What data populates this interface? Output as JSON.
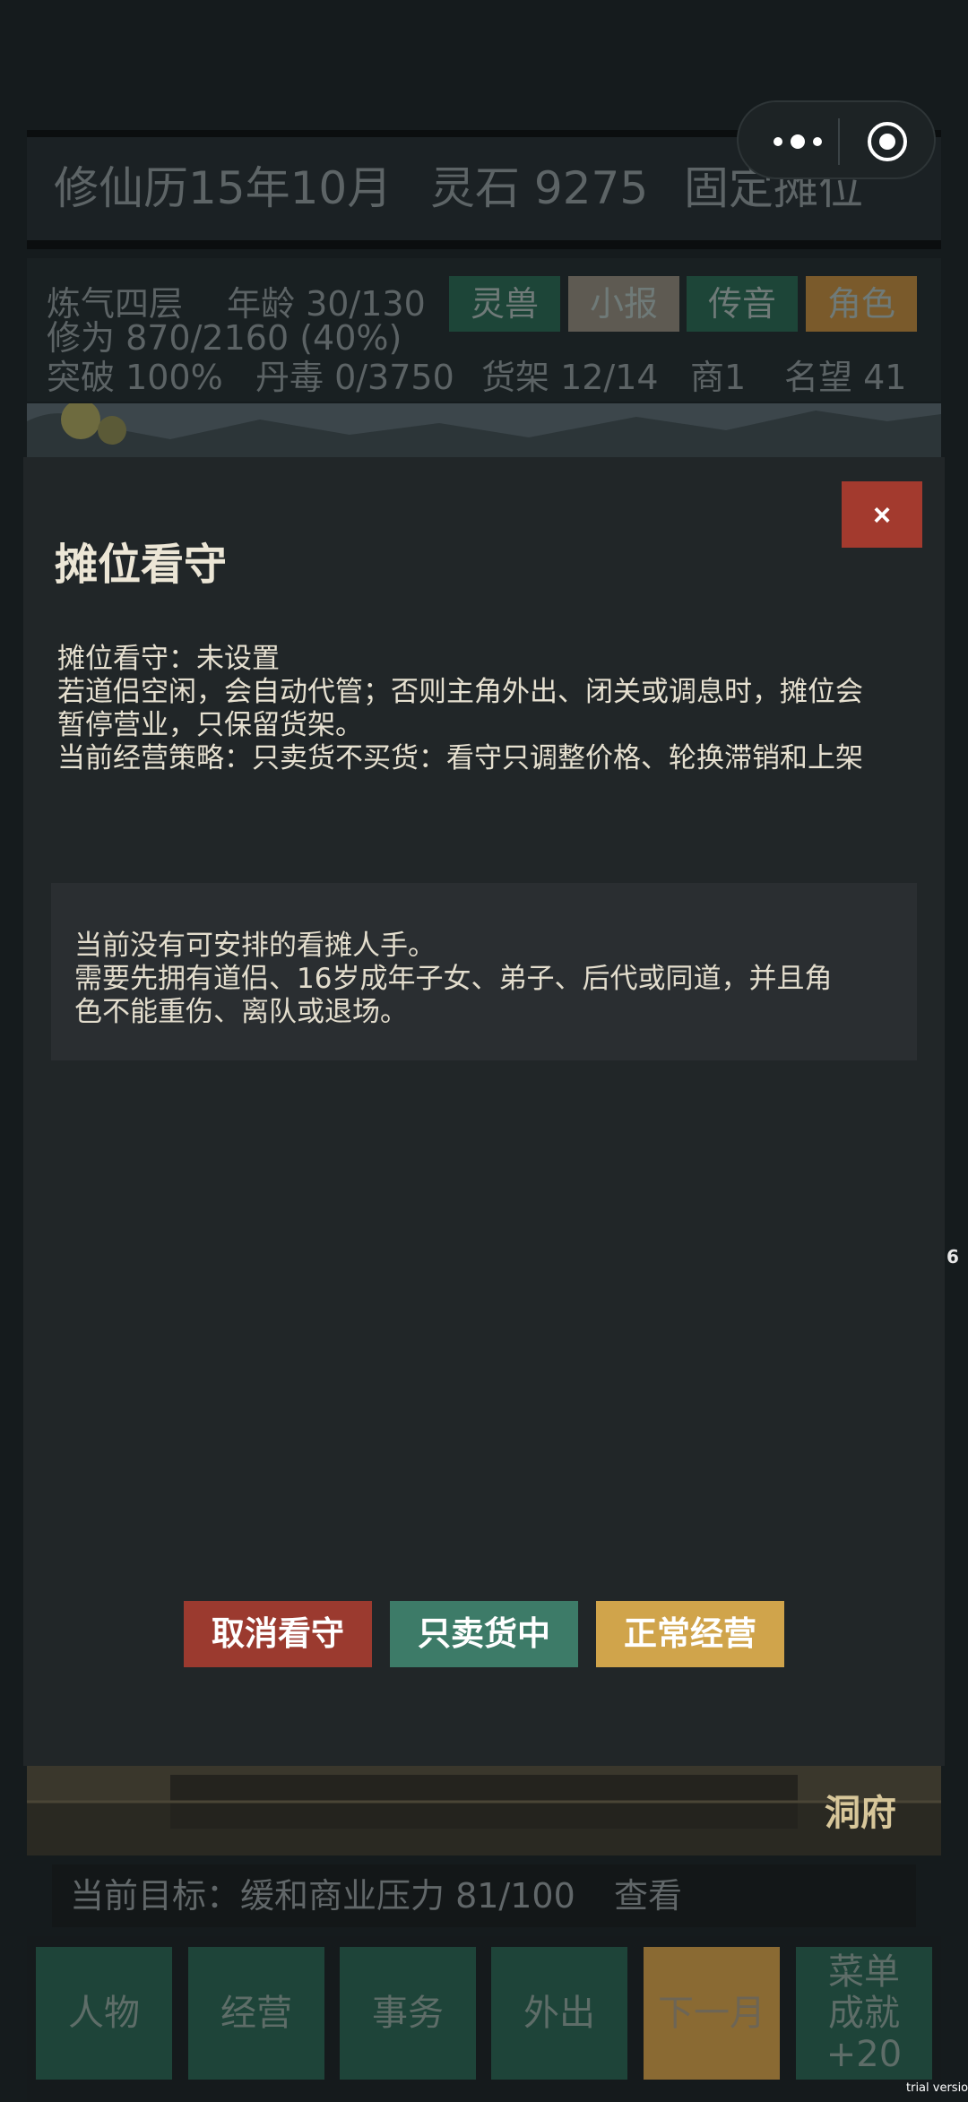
{
  "topbar": {
    "date": "修仙历15年10月",
    "spirit_stones": "灵石 9275",
    "stall_mode": "固定摊位"
  },
  "status": {
    "realm": "炼气四层",
    "age": "年龄 30/130",
    "cultivation": "修为 870/2160 (40%)",
    "breakthrough": "突破 100%",
    "pill_poison": "丹毒 0/3750",
    "shelves": "货架 12/14",
    "merchant": "商1",
    "fame": "名望 41",
    "buttons": [
      "灵兽",
      "小报",
      "传音",
      "角色"
    ]
  },
  "modal": {
    "close_label": "×",
    "title": "摊位看守",
    "info_lines": [
      "摊位看守：未设置",
      "若道侣空闲，会自动代管；否则主角外出、闭关或调息时，摊位会",
      "暂停营业，只保留货架。",
      "当前经营策略：只卖货不买货：看守只调整价格、轮换滞销和上架"
    ],
    "notice_lines": [
      "当前没有可安排的看摊人手。",
      "需要先拥有道侣、16岁成年子女、弟子、后代或同道，并且角",
      "色不能重伤、离队或退场。"
    ],
    "buttons": {
      "cancel": "取消看守",
      "sell_only": "只卖货中",
      "normal": "正常经营"
    }
  },
  "background": {
    "dongfu": "洞府",
    "right_number": "6"
  },
  "goal": {
    "text": "当前目标：缓和商业压力 81/100",
    "view": "查看"
  },
  "nav": {
    "character": "人物",
    "business": "经营",
    "affairs": "事务",
    "outing": "外出",
    "next_month": "下一月",
    "menu": "菜单",
    "achievement": "成就+20"
  },
  "watermark": "trial version",
  "colors": {
    "close_red": "#a33a2e",
    "cancel_red": "#9b3a2f",
    "sell_green": "#3d7b68",
    "normal_gold": "#d0a44b",
    "nav_green": "#1e4439",
    "nav_gold": "#8a6a33"
  },
  "icons": {
    "menu": "more-dots-icon",
    "close_app": "target-circle-icon"
  }
}
